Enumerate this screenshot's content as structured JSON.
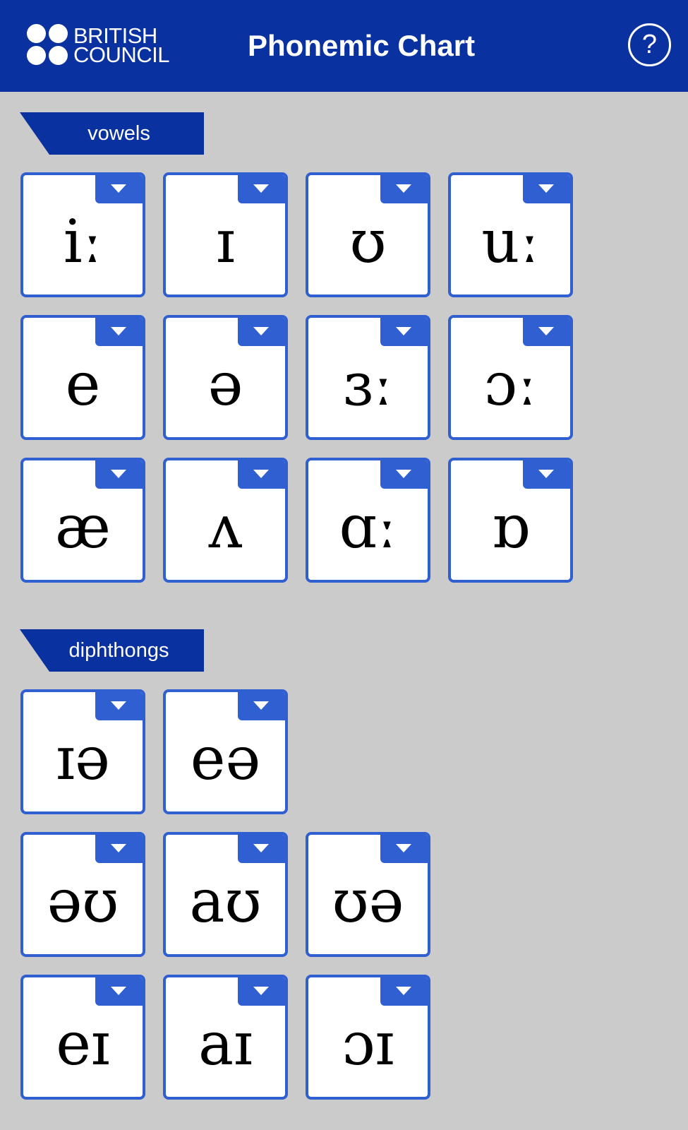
{
  "header": {
    "logo_line1": "BRITISH",
    "logo_line2": "COUNCIL",
    "title": "Phonemic Chart",
    "help_label": "?"
  },
  "colors": {
    "header_bg": "#0a31a0",
    "card_border": "#2f5fd0",
    "background": "#cbcbcb"
  },
  "sections": {
    "vowels": {
      "label": "vowels",
      "symbols": [
        "iː",
        "ɪ",
        "ʊ",
        "uː",
        "e",
        "ə",
        "ɜː",
        "ɔː",
        "æ",
        "ʌ",
        "ɑː",
        "ɒ"
      ]
    },
    "diphthongs": {
      "label": "diphthongs",
      "symbols": [
        "ɪə",
        "eə",
        "əʊ",
        "aʊ",
        "ʊə",
        "eɪ",
        "aɪ",
        "ɔɪ"
      ]
    }
  },
  "card_icon": "chevron-down-icon"
}
